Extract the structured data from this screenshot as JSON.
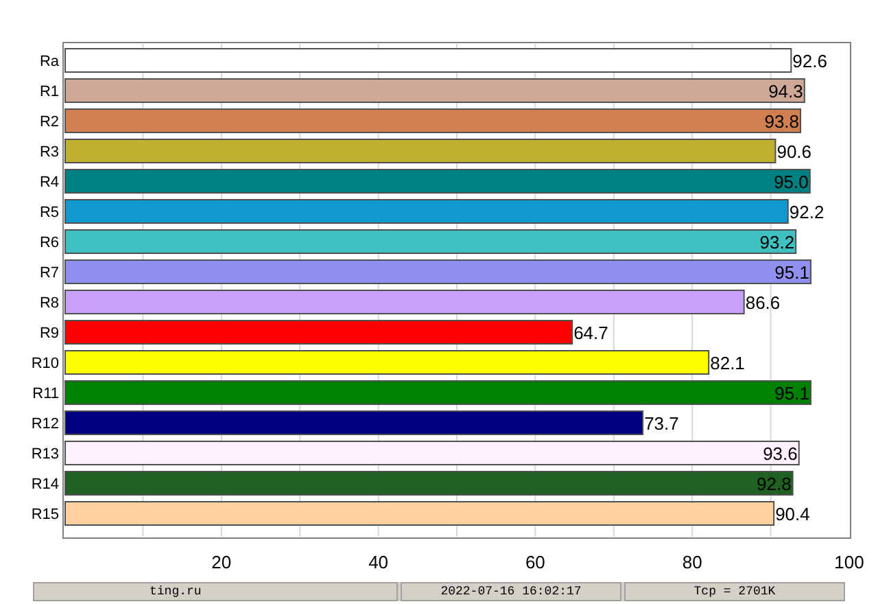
{
  "chart_data": {
    "type": "bar",
    "orientation": "horizontal",
    "categories": [
      "Ra",
      "R1",
      "R2",
      "R3",
      "R4",
      "R5",
      "R6",
      "R7",
      "R8",
      "R9",
      "R10",
      "R11",
      "R12",
      "R13",
      "R14",
      "R15"
    ],
    "series": [
      {
        "values": [
          92.6,
          94.3,
          93.8,
          90.6,
          95.0,
          92.2,
          93.2,
          95.1,
          86.6,
          64.7,
          82.1,
          95.1,
          73.7,
          93.6,
          92.8,
          90.4
        ],
        "colors": [
          "#ffffff",
          "#d0a898",
          "#d08050",
          "#c0b030",
          "#008080",
          "#1098d0",
          "#40c0c0",
          "#9090f0",
          "#c8a0f8",
          "#ff0000",
          "#ffff00",
          "#008000",
          "#000080",
          "#fff0ff",
          "#206020",
          "#ffd0a0"
        ]
      }
    ],
    "value_labels": [
      "92.6",
      "94.3",
      "93.8",
      "90.6",
      "95.0",
      "92.2",
      "93.2",
      "95.1",
      "86.6",
      "64.7",
      "82.1",
      "95.1",
      "73.7",
      "93.6",
      "92.8",
      "90.4"
    ],
    "xlim": [
      0,
      100
    ],
    "xticks": [
      20,
      40,
      60,
      80,
      100
    ],
    "grid": true
  },
  "status_bar": [
    "ting.ru",
    "2022-07-16 16:02:17",
    "Tcp = 2701K"
  ]
}
